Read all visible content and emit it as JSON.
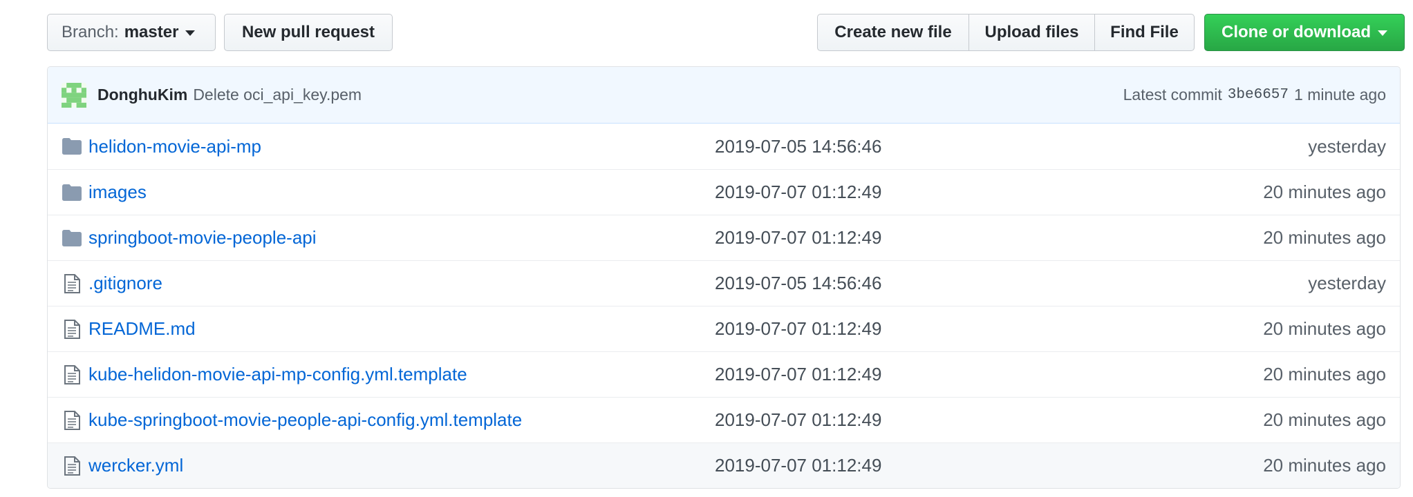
{
  "toolbar": {
    "branch_prefix": "Branch:",
    "branch_name": "master",
    "new_pull_request": "New pull request",
    "create_new_file": "Create new file",
    "upload_files": "Upload files",
    "find_file": "Find File",
    "clone_or_download": "Clone or download"
  },
  "commit": {
    "author": "DonghuKim",
    "message": "Delete oci_api_key.pem",
    "latest_label": "Latest commit",
    "sha": "3be6657",
    "age": "1 minute ago"
  },
  "files": [
    {
      "type": "folder",
      "name": "helidon-movie-api-mp",
      "date": "2019-07-05 14:56:46",
      "age": "yesterday"
    },
    {
      "type": "folder",
      "name": "images",
      "date": "2019-07-07 01:12:49",
      "age": "20 minutes ago"
    },
    {
      "type": "folder",
      "name": "springboot-movie-people-api",
      "date": "2019-07-07 01:12:49",
      "age": "20 minutes ago"
    },
    {
      "type": "file",
      "name": ".gitignore",
      "date": "2019-07-05 14:56:46",
      "age": "yesterday"
    },
    {
      "type": "file",
      "name": "README.md",
      "date": "2019-07-07 01:12:49",
      "age": "20 minutes ago"
    },
    {
      "type": "file",
      "name": "kube-helidon-movie-api-mp-config.yml.template",
      "date": "2019-07-07 01:12:49",
      "age": "20 minutes ago"
    },
    {
      "type": "file",
      "name": "kube-springboot-movie-people-api-config.yml.template",
      "date": "2019-07-07 01:12:49",
      "age": "20 minutes ago"
    },
    {
      "type": "file",
      "name": "wercker.yml",
      "date": "2019-07-07 01:12:49",
      "age": "20 minutes ago"
    }
  ],
  "colors": {
    "link": "#0366d6",
    "clone_green": "#28a745",
    "commit_bar_bg": "#f1f8ff",
    "folder_icon": "#79b8ff",
    "avatar_green": "#7fd37f"
  },
  "icons": {
    "caret": "chevron-down-icon",
    "folder": "folder-icon",
    "file": "file-icon",
    "avatar": "identicon-avatar"
  }
}
